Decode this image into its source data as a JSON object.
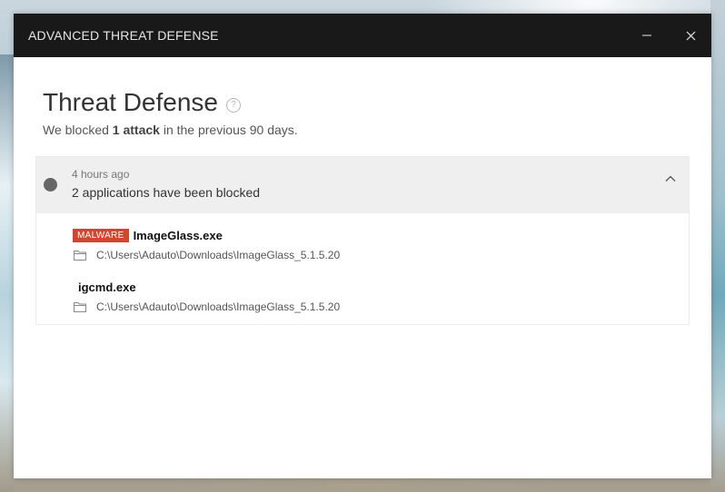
{
  "window": {
    "title": "ADVANCED THREAT DEFENSE"
  },
  "page": {
    "heading": "Threat Defense",
    "help_glyph": "?",
    "summary_prefix": "We blocked ",
    "summary_count": "1 attack",
    "summary_suffix": " in the previous 90 days."
  },
  "event": {
    "time": "4 hours ago",
    "description": "2 applications have been blocked",
    "expanded": true,
    "applications": [
      {
        "badge": "MALWARE",
        "name": "ImageGlass.exe",
        "path": "C:\\Users\\Adauto\\Downloads\\ImageGlass_5.1.5.20"
      },
      {
        "badge": "",
        "name": "igcmd.exe",
        "path": "C:\\Users\\Adauto\\Downloads\\ImageGlass_5.1.5.20"
      }
    ]
  },
  "icons": {
    "minimize": "minimize-icon",
    "close": "close-icon",
    "help": "help-icon",
    "status": "status-dot-icon",
    "collapse": "chevron-up-icon",
    "folder": "folder-icon"
  },
  "colors": {
    "titlebar": "#191919",
    "malware_badge": "#d0462e",
    "status_dot": "#666666"
  }
}
